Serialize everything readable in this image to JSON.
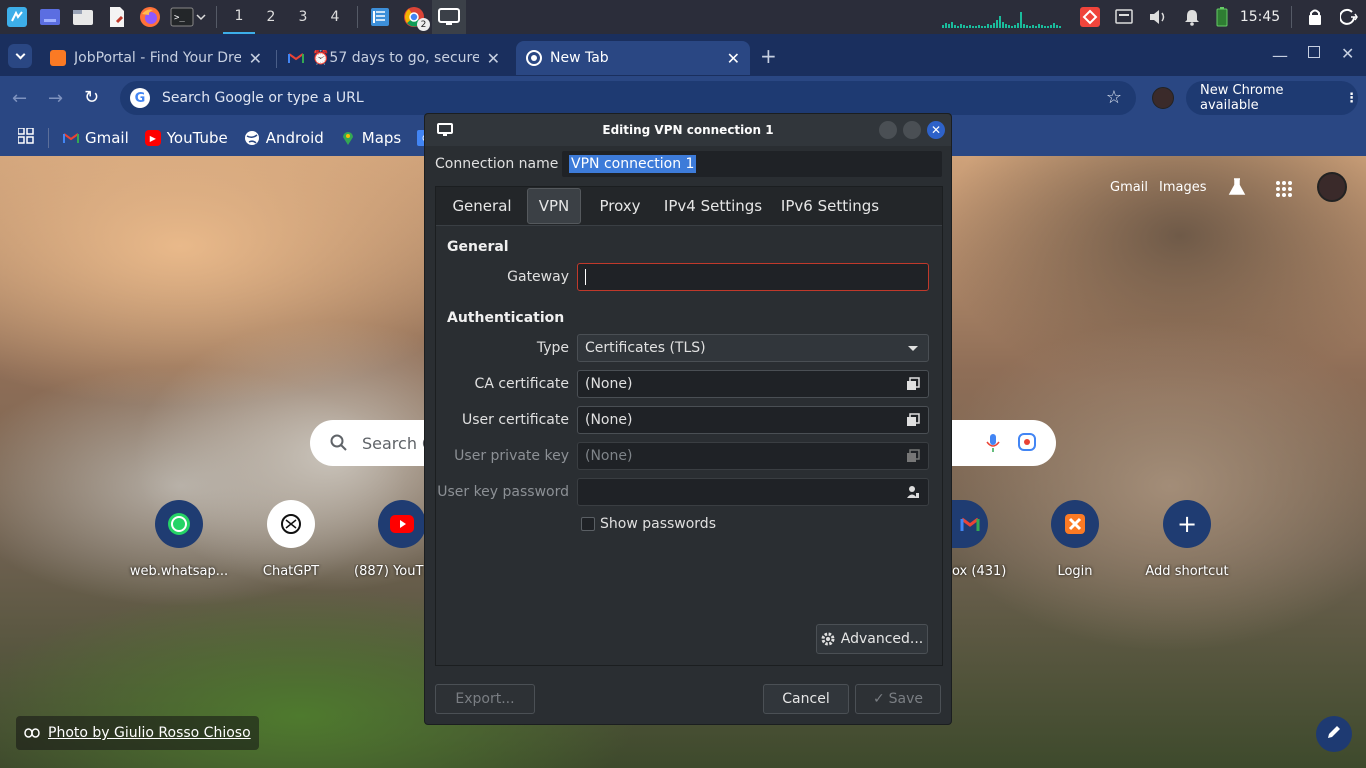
{
  "panel": {
    "desktops": [
      "1",
      "2",
      "3",
      "4"
    ],
    "chrome_badge": "2",
    "clock": "15:45"
  },
  "chrome": {
    "tabs": [
      {
        "title": "JobPortal - Find Your Dre",
        "icon": "xampp-icon"
      },
      {
        "title": "⏰57 days to go, secure y",
        "icon": "gmail-icon"
      },
      {
        "title": "New Tab",
        "icon": "chrome-icon"
      }
    ],
    "omnibox_placeholder": "Search Google or type a URL",
    "update_button": "New Chrome available",
    "bookmarks": [
      "Gmail",
      "YouTube",
      "Android",
      "Maps"
    ]
  },
  "ntp": {
    "top_links": [
      "Gmail",
      "Images"
    ],
    "search_placeholder": "Search G",
    "shortcuts": [
      {
        "label": "web.whatsap...",
        "icon": "whatsapp-icon"
      },
      {
        "label": "ChatGPT",
        "icon": "chatgpt-icon"
      },
      {
        "label": "(887) YouT",
        "icon": "youtube-icon"
      },
      {
        "label": "ox (431)",
        "icon": "gmail-icon"
      },
      {
        "label": "Login",
        "icon": "xampp-icon"
      },
      {
        "label": "Add shortcut",
        "icon": "plus-icon"
      }
    ],
    "photo_credit": "Photo by Giulio Rosso Chioso"
  },
  "dialog": {
    "title": "Editing VPN connection 1",
    "connection_name_label": "Connection name",
    "connection_name_value": "VPN connection 1",
    "tabs": [
      "General",
      "VPN",
      "Proxy",
      "IPv4 Settings",
      "IPv6 Settings"
    ],
    "active_tab": "VPN",
    "general_heading": "General",
    "gateway_label": "Gateway",
    "gateway_value": "",
    "auth_heading": "Authentication",
    "type_label": "Type",
    "type_value": "Certificates (TLS)",
    "ca_label": "CA certificate",
    "ca_value": "(None)",
    "user_cert_label": "User certificate",
    "user_cert_value": "(None)",
    "private_key_label": "User private key",
    "private_key_value": "(None)",
    "key_password_label": "User key password",
    "show_passwords": "Show passwords",
    "advanced_button": "Advanced...",
    "export_button": "Export...",
    "cancel_button": "Cancel",
    "save_button": "Save"
  },
  "colors": {
    "accent": "#3daee9",
    "selection": "#3d7bd9",
    "error_border": "#c0392b",
    "chrome_blue": "#2a4783",
    "close_blue": "#2e62c9"
  }
}
